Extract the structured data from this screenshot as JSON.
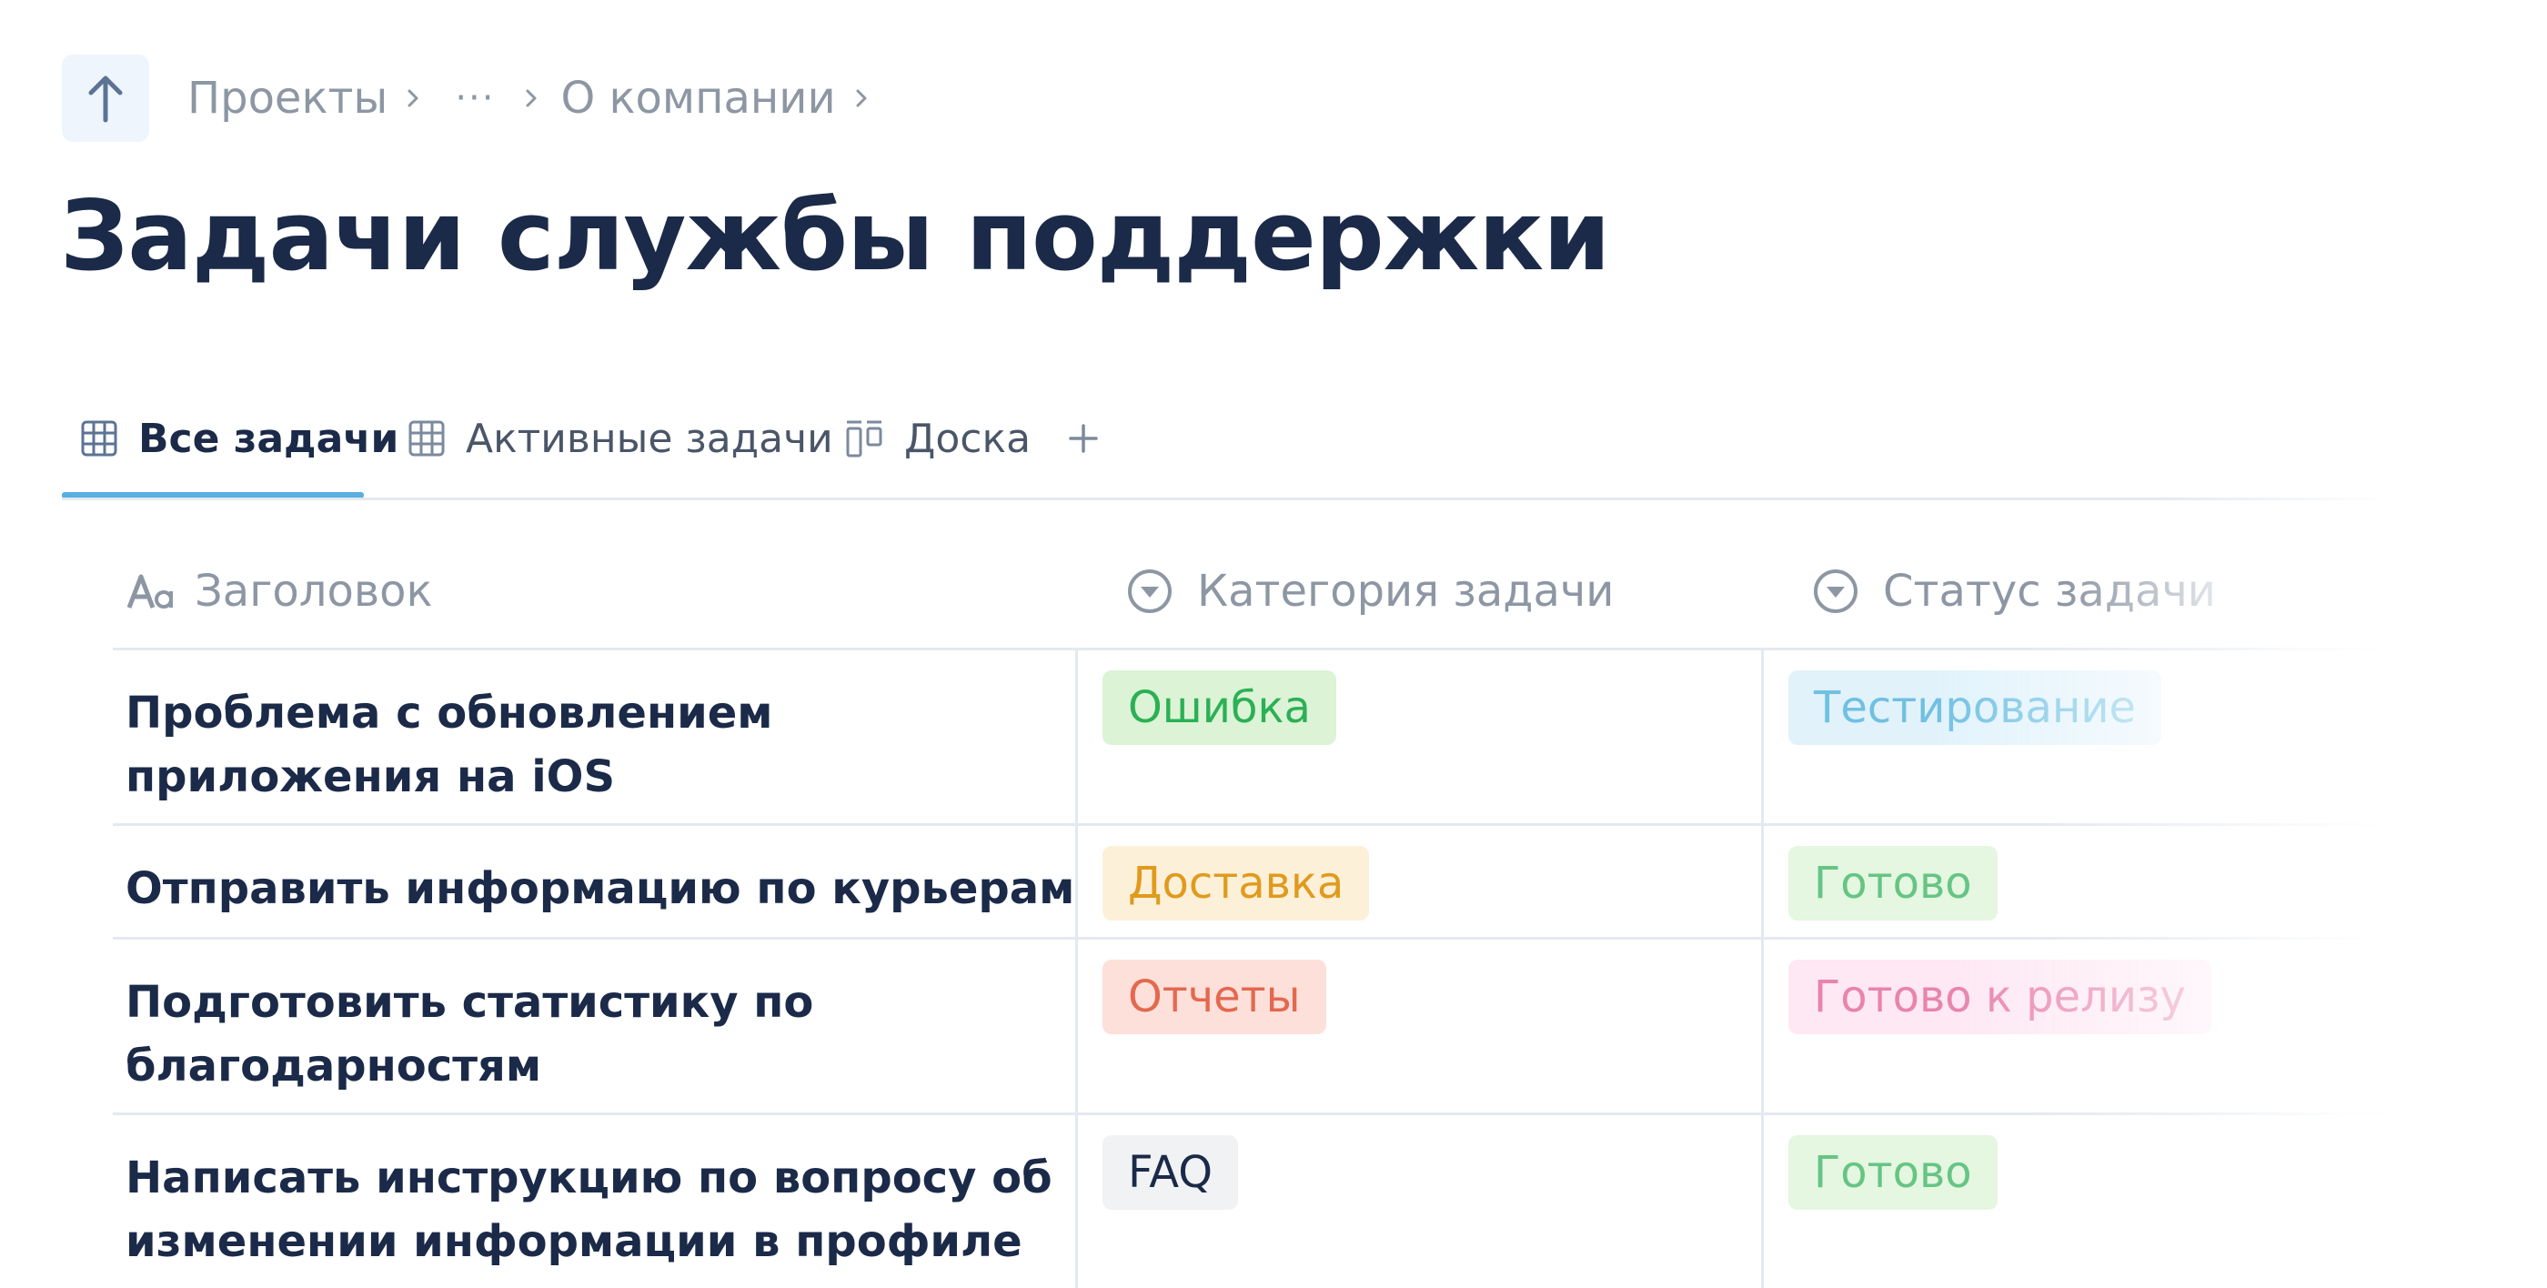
{
  "breadcrumb": {
    "items": [
      "Проекты",
      "···",
      "О компании"
    ],
    "up_icon": "arrow-up-icon",
    "separator_icon": "chevron-right-icon"
  },
  "page": {
    "title": "Задачи службы поддержки"
  },
  "tabs": [
    {
      "label": "Все задачи",
      "icon": "table-grid-icon",
      "active": true
    },
    {
      "label": "Активные задачи",
      "icon": "table-grid-icon",
      "active": false
    },
    {
      "label": "Доска",
      "icon": "board-columns-icon",
      "active": false
    }
  ],
  "tabs_add_icon": "plus-icon",
  "colors": {
    "accent": "#5aaee0",
    "text": "#1b2a48",
    "muted": "#8d97a4"
  },
  "table": {
    "columns": [
      {
        "label": "Заголовок",
        "icon": "text-aa-icon"
      },
      {
        "label": "Категория задачи",
        "icon": "select-dropdown-icon"
      },
      {
        "label": "Статус задачи",
        "icon": "select-dropdown-icon"
      }
    ],
    "rows": [
      {
        "title": "Проблема с обновлением приложения на iOS",
        "category": {
          "label": "Ошибка",
          "bg": "#dcf3d6",
          "fg": "#2bb055"
        },
        "status": {
          "label": "Тестирование",
          "bg": "#d6eefa",
          "fg": "#3aa9d8"
        }
      },
      {
        "title": "Отправить информацию по курьерам",
        "category": {
          "label": "Доставка",
          "bg": "#fdf0d9",
          "fg": "#e09a1c"
        },
        "status": {
          "label": "Готово",
          "bg": "#dcf3d6",
          "fg": "#2bb055"
        }
      },
      {
        "title": "Подготовить статистику по благодарностям",
        "category": {
          "label": "Отчеты",
          "bg": "#fde0da",
          "fg": "#e4684f"
        },
        "status": {
          "label": "Готово к релизу",
          "bg": "#fde0ef",
          "fg": "#e0568e"
        }
      },
      {
        "title": "Написать инструкцию по вопросу об изменении информации в профиле",
        "category": {
          "label": "FAQ",
          "bg": "#f0f2f4",
          "fg": "#1b2a48"
        },
        "status": {
          "label": "Готово",
          "bg": "#dcf3d6",
          "fg": "#2bb055"
        }
      }
    ]
  }
}
